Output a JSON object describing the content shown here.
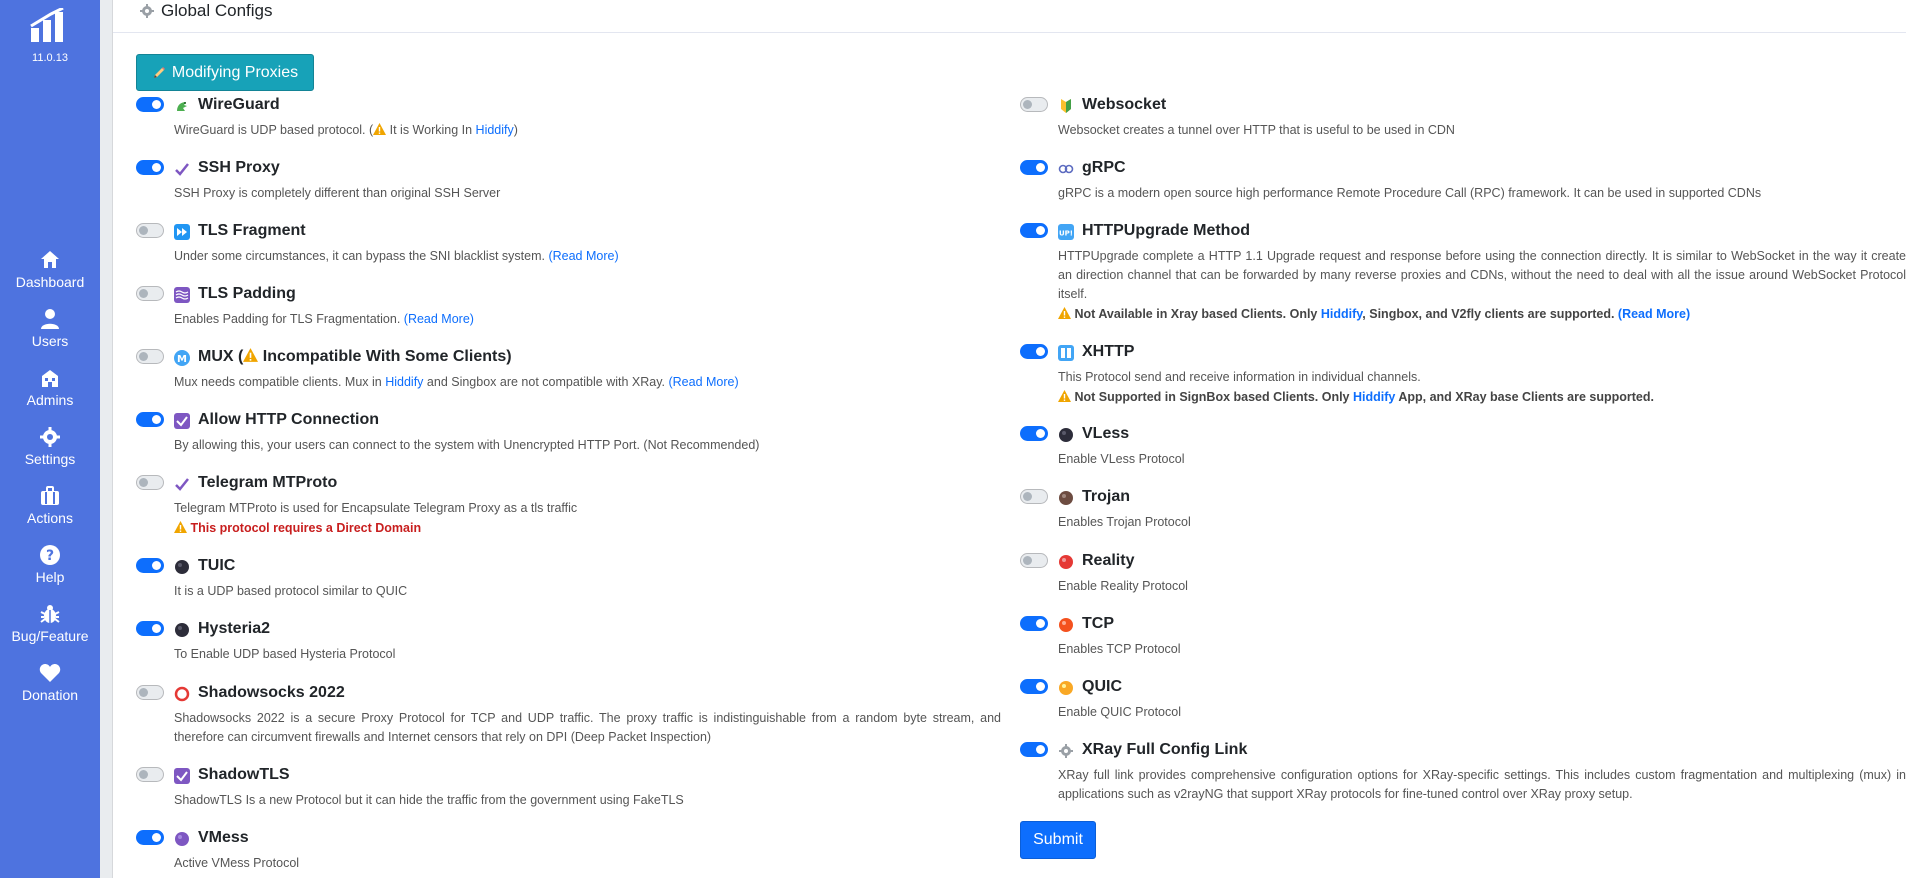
{
  "sidebar": {
    "version": "11.0.13",
    "items": [
      {
        "label": "Dashboard",
        "icon": "home-icon"
      },
      {
        "label": "Users",
        "icon": "user-icon"
      },
      {
        "label": "Admins",
        "icon": "admin-icon"
      },
      {
        "label": "Settings",
        "icon": "gear-icon"
      },
      {
        "label": "Actions",
        "icon": "briefcase-icon"
      },
      {
        "label": "Help",
        "icon": "question-icon"
      },
      {
        "label": "Bug/Feature",
        "icon": "bug-icon"
      },
      {
        "label": "Donation",
        "icon": "heart-icon"
      }
    ]
  },
  "header": {
    "title": "Global Configs"
  },
  "modify_button": "Modifying Proxies",
  "submit_label": "Submit",
  "left": [
    {
      "name": "WireGuard",
      "enabled": true,
      "desc_a": "WireGuard is UDP based protocol. (",
      "desc_b": " It is Working In ",
      "desc_link": "Hiddify",
      "desc_c": ")"
    },
    {
      "name": "SSH Proxy",
      "enabled": true,
      "desc": "SSH Proxy is completely different than original SSH Server"
    },
    {
      "name": "TLS Fragment",
      "enabled": false,
      "desc": "Under some circumstances, it can bypass the SNI blacklist system. ",
      "link": "(Read More)"
    },
    {
      "name": "TLS Padding",
      "enabled": false,
      "desc": "Enables Padding for TLS Fragmentation. ",
      "link": "(Read More)"
    },
    {
      "name_a": "MUX (",
      "name_b": " Incompatible With Some Clients)",
      "enabled": false,
      "desc_a": "Mux needs compatible clients. Mux in ",
      "desc_link": "Hiddify",
      "desc_b": " and Singbox are not compatible with XRay. ",
      "link": "(Read More)"
    },
    {
      "name": "Allow HTTP Connection",
      "enabled": true,
      "desc": "By allowing this, your users can connect to the system with Unencrypted HTTP Port. (Not Recommended)"
    },
    {
      "name": "Telegram MTProto",
      "enabled": false,
      "desc": "Telegram MTProto is used for Encapsulate Telegram Proxy as a tls traffic",
      "warn": "This protocol requires a Direct Domain"
    },
    {
      "name": "TUIC",
      "enabled": true,
      "desc": "It is a UDP based protocol similar to QUIC"
    },
    {
      "name": "Hysteria2",
      "enabled": true,
      "desc": "To Enable UDP based Hysteria Protocol"
    },
    {
      "name": "Shadowsocks 2022",
      "enabled": false,
      "desc": "Shadowsocks 2022 is a secure Proxy Protocol for TCP and UDP traffic. The proxy traffic is indistinguishable from a random byte stream, and therefore can circumvent firewalls and Internet censors that rely on DPI (Deep Packet Inspection)"
    },
    {
      "name": "ShadowTLS",
      "enabled": false,
      "desc": "ShadowTLS Is a new Protocol but it can hide the traffic from the government using FakeTLS"
    },
    {
      "name": "VMess",
      "enabled": true,
      "desc": "Active VMess Protocol"
    }
  ],
  "right": [
    {
      "name": "Websocket",
      "enabled": false,
      "desc": "Websocket creates a tunnel over HTTP that is useful to be used in CDN"
    },
    {
      "name": "gRPC",
      "enabled": true,
      "desc": "gRPC is a modern open source high performance Remote Procedure Call (RPC) framework. It can be used in supported CDNs"
    },
    {
      "name": "HTTPUpgrade Method",
      "enabled": true,
      "desc": "HTTPUpgrade complete a HTTP 1.1 Upgrade request and response before using the connection directly. It is similar to WebSocket in the way it create an direction channel that can be forwarded by many reverse proxies and CDNs, without the need to deal with all the issue around WebSocket Protocol itself.",
      "warn_a": "Not Available in Xray based Clients. Only ",
      "warn_link": "Hiddify",
      "warn_b": ", Singbox, and V2fly clients are supported. ",
      "warn_more": "(Read More)"
    },
    {
      "name": "XHTTP",
      "enabled": true,
      "desc": "This Protocol send and receive information in individual channels.",
      "warn_a": "Not Supported in SignBox based Clients. Only ",
      "warn_link": "Hiddify",
      "warn_b": " App, and XRay base Clients are supported."
    },
    {
      "name": "VLess",
      "enabled": true,
      "desc": "Enable VLess Protocol"
    },
    {
      "name": "Trojan",
      "enabled": false,
      "desc": "Enables Trojan Protocol"
    },
    {
      "name": "Reality",
      "enabled": false,
      "desc": "Enable Reality Protocol"
    },
    {
      "name": "TCP",
      "enabled": true,
      "desc": "Enables TCP Protocol"
    },
    {
      "name": "QUIC",
      "enabled": true,
      "desc": "Enable QUIC Protocol"
    },
    {
      "name": "XRay Full Config Link",
      "enabled": true,
      "desc": "XRay full link provides comprehensive configuration options for XRay-specific settings. This includes custom fragmentation and multiplexing (mux) in applications such as v2rayNG that support XRay protocols for fine-tuned control over XRay proxy setup."
    }
  ]
}
